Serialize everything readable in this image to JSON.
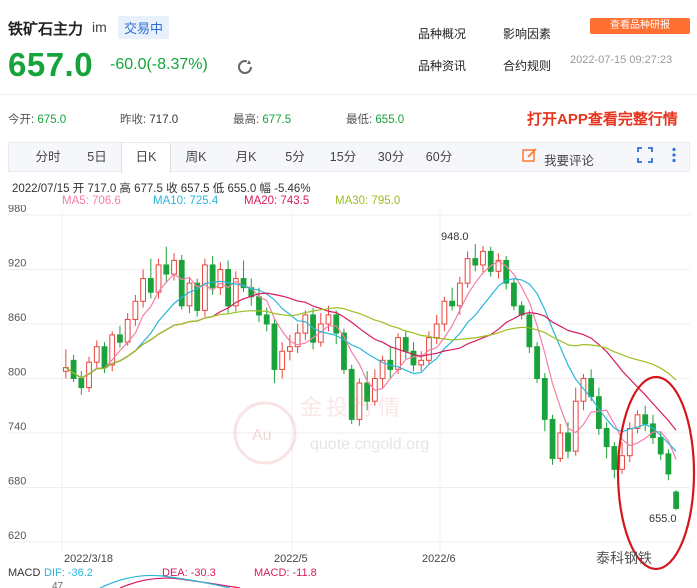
{
  "header": {
    "name": "铁矿石主力",
    "code": "im",
    "status": "交易中",
    "price": "657.0",
    "change": "-60.0(-8.37%)",
    "links": [
      "品种概况",
      "影响因素",
      "品种资讯",
      "合约规则"
    ],
    "app_badge": "查看品种研报",
    "datetime": "2022-07-15 09:27:23"
  },
  "stats": {
    "open_label": "今开:",
    "open": "675.0",
    "prev_label": "昨收:",
    "prev": "717.0",
    "high_label": "最高:",
    "high": "677.5",
    "low_label": "最低:",
    "low": "655.0",
    "open_app": "打开APP查看完整行情"
  },
  "tabs": [
    {
      "label": "分时",
      "active": false
    },
    {
      "label": "5日",
      "active": false
    },
    {
      "label": "日K",
      "active": true
    },
    {
      "label": "周K",
      "active": false
    },
    {
      "label": "月K",
      "active": false
    },
    {
      "label": "5分",
      "active": false
    },
    {
      "label": "15分",
      "active": false
    },
    {
      "label": "30分",
      "active": false
    },
    {
      "label": "60分",
      "active": false
    }
  ],
  "comment_label": "我要评论",
  "ohlc_line": "2022/07/15  开 717.0  高 677.5  收 657.5  低 655.0  幅 -5.46%",
  "ma": {
    "ma5": "MA5: 706.6",
    "ma10": "MA10: 725.4",
    "ma20": "MA20: 743.5",
    "ma30": "MA30: 795.0",
    "colors": {
      "ma5": "#f47fa8",
      "ma10": "#29b6d8",
      "ma20": "#d81b60",
      "ma30": "#9bbf1f"
    }
  },
  "macd": {
    "label": "MACD",
    "dif": "DIF: -36.2",
    "dea": "DEA: -30.3",
    "macd": "MACD: -11.8",
    "axis_top": "47"
  },
  "watermark": {
    "cn": "金投行情",
    "url": "quote.cngold.org",
    "badge": "Au",
    "corner": "泰科钢铁"
  },
  "colors": {
    "up": "#e8453c",
    "down": "#1aa33a",
    "circle": "#d4161b"
  },
  "chart_data": {
    "type": "candlestick",
    "yaxis": [
      980,
      920,
      860,
      800,
      740,
      680,
      620
    ],
    "ylim": [
      620,
      980
    ],
    "xlabels": [
      "2022/3/18",
      "2022/5",
      "2022/6"
    ],
    "annotations": {
      "max": "948.0",
      "min": "655.0"
    },
    "candles": [
      [
        808,
        812,
        832,
        800
      ],
      [
        820,
        800,
        826,
        796
      ],
      [
        800,
        790,
        808,
        782
      ],
      [
        790,
        818,
        824,
        785
      ],
      [
        818,
        835,
        842,
        812
      ],
      [
        835,
        812,
        840,
        806
      ],
      [
        815,
        848,
        852,
        808
      ],
      [
        848,
        840,
        858,
        834
      ],
      [
        840,
        865,
        872,
        836
      ],
      [
        865,
        885,
        892,
        858
      ],
      [
        885,
        910,
        920,
        878
      ],
      [
        910,
        895,
        932,
        888
      ],
      [
        895,
        925,
        932,
        888
      ],
      [
        925,
        915,
        945,
        905
      ],
      [
        915,
        930,
        938,
        908
      ],
      [
        930,
        880,
        936,
        876
      ],
      [
        880,
        905,
        912,
        872
      ],
      [
        905,
        875,
        910,
        868
      ],
      [
        875,
        925,
        932,
        868
      ],
      [
        925,
        900,
        935,
        892
      ],
      [
        900,
        920,
        928,
        892
      ],
      [
        920,
        880,
        930,
        872
      ],
      [
        880,
        910,
        918,
        874
      ],
      [
        910,
        900,
        930,
        895
      ],
      [
        900,
        890,
        910,
        880
      ],
      [
        890,
        870,
        900,
        862
      ],
      [
        870,
        860,
        878,
        852
      ],
      [
        860,
        810,
        865,
        795
      ],
      [
        810,
        830,
        840,
        800
      ],
      [
        830,
        835,
        848,
        820
      ],
      [
        835,
        850,
        860,
        828
      ],
      [
        850,
        870,
        875,
        842
      ],
      [
        870,
        840,
        878,
        832
      ],
      [
        840,
        860,
        872,
        835
      ],
      [
        860,
        870,
        880,
        852
      ],
      [
        870,
        850,
        875,
        838
      ],
      [
        850,
        810,
        855,
        805
      ],
      [
        810,
        755,
        815,
        750
      ],
      [
        755,
        795,
        800,
        748
      ],
      [
        795,
        775,
        808,
        765
      ],
      [
        775,
        800,
        810,
        770
      ],
      [
        800,
        820,
        825,
        790
      ],
      [
        820,
        810,
        835,
        800
      ],
      [
        810,
        845,
        850,
        805
      ],
      [
        845,
        830,
        852,
        822
      ],
      [
        830,
        815,
        840,
        808
      ],
      [
        815,
        820,
        830,
        808
      ],
      [
        820,
        845,
        852,
        815
      ],
      [
        845,
        860,
        870,
        838
      ],
      [
        860,
        885,
        890,
        852
      ],
      [
        885,
        880,
        900,
        875
      ],
      [
        880,
        905,
        912,
        870
      ],
      [
        905,
        932,
        940,
        900
      ],
      [
        932,
        925,
        948,
        918
      ],
      [
        925,
        940,
        946,
        915
      ],
      [
        940,
        918,
        945,
        912
      ],
      [
        918,
        930,
        938,
        910
      ],
      [
        930,
        905,
        935,
        898
      ],
      [
        905,
        880,
        910,
        875
      ],
      [
        880,
        870,
        885,
        865
      ],
      [
        870,
        835,
        875,
        828
      ],
      [
        835,
        800,
        840,
        795
      ],
      [
        800,
        755,
        806,
        742
      ],
      [
        755,
        712,
        760,
        705
      ],
      [
        712,
        740,
        750,
        708
      ],
      [
        740,
        720,
        752,
        712
      ],
      [
        720,
        775,
        790,
        715
      ],
      [
        775,
        800,
        805,
        765
      ],
      [
        800,
        780,
        810,
        775
      ],
      [
        780,
        745,
        790,
        738
      ],
      [
        745,
        725,
        752,
        712
      ],
      [
        725,
        700,
        730,
        690
      ],
      [
        700,
        715,
        730,
        695
      ],
      [
        715,
        745,
        752,
        708
      ],
      [
        745,
        760,
        765,
        740
      ],
      [
        760,
        750,
        770,
        742
      ],
      [
        750,
        735,
        760,
        728
      ],
      [
        735,
        717,
        742,
        710
      ],
      [
        717,
        695,
        722,
        688
      ],
      [
        675,
        657,
        677,
        655
      ]
    ]
  }
}
